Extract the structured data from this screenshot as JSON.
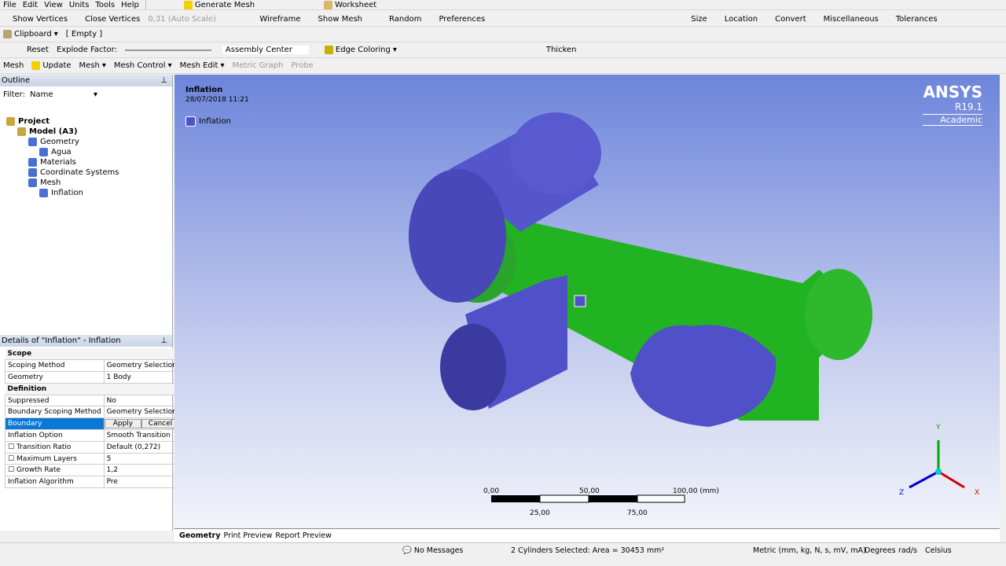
{
  "menu": [
    "File",
    "Edit",
    "View",
    "Units",
    "Tools",
    "Help"
  ],
  "toolbar1": {
    "generate_mesh": "Generate Mesh",
    "worksheet": "Worksheet"
  },
  "toolbar2": {
    "show_vertices": "Show Vertices",
    "close_vertices": "Close Vertices",
    "scale": "0,31 (Auto Scale)",
    "wireframe": "Wireframe",
    "show_mesh": "Show Mesh",
    "random": "Random",
    "preferences": "Preferences",
    "size": "Size",
    "location": "Location",
    "convert": "Convert",
    "miscellaneous": "Miscellaneous",
    "tolerances": "Tolerances"
  },
  "toolbar3": {
    "clipboard": "Clipboard",
    "clipboard_value": "[ Empty ]"
  },
  "toolbar4": {
    "reset": "Reset",
    "explode_factor": "Explode Factor:",
    "assembly_center": "Assembly Center",
    "edge_coloring": "Edge Coloring",
    "thicken": "Thicken"
  },
  "toolbar5": {
    "mesh_label": "Mesh",
    "update": "Update",
    "mesh": "Mesh",
    "mesh_control": "Mesh Control",
    "mesh_edit": "Mesh Edit",
    "metric_graph": "Metric Graph",
    "probe": "Probe"
  },
  "outline": {
    "title": "Outline",
    "filter_label": "Filter:",
    "filter_value": "Name",
    "tree": [
      {
        "label": "Project",
        "bold": true,
        "indent": 0
      },
      {
        "label": "Model (A3)",
        "bold": true,
        "indent": 1
      },
      {
        "label": "Geometry",
        "indent": 2
      },
      {
        "label": "Agua",
        "indent": 3
      },
      {
        "label": "Materials",
        "indent": 2
      },
      {
        "label": "Coordinate Systems",
        "indent": 2
      },
      {
        "label": "Mesh",
        "indent": 2
      },
      {
        "label": "Inflation",
        "indent": 3
      }
    ]
  },
  "details": {
    "title": "Details of \"Inflation\" - Inflation",
    "scope": "Scope",
    "scoping_method": [
      "Scoping Method",
      "Geometry Selection"
    ],
    "geometry": [
      "Geometry",
      "1 Body"
    ],
    "definition": "Definition",
    "suppressed": [
      "Suppressed",
      "No"
    ],
    "boundary_scoping": [
      "Boundary Scoping Method",
      "Geometry Selection"
    ],
    "boundary": "Boundary",
    "apply": "Apply",
    "cancel": "Cancel",
    "inflation_option": [
      "Inflation Option",
      "Smooth Transition"
    ],
    "transition_ratio": [
      "Transition Ratio",
      "Default (0,272)"
    ],
    "max_layers": [
      "Maximum Layers",
      "5"
    ],
    "growth_rate": [
      "Growth Rate",
      "1,2"
    ],
    "algorithm": [
      "Inflation Algorithm",
      "Pre"
    ]
  },
  "viewport": {
    "title": "Inflation",
    "date": "28/07/2018 11:21",
    "legend": "Inflation",
    "brand": "ANSYS",
    "version": "R19.1",
    "edition": "Academic",
    "scale_top": [
      "0,00",
      "50,00",
      "100,00 (mm)"
    ],
    "scale_bottom": [
      "25,00",
      "75,00"
    ],
    "axes": [
      "Y",
      "Z",
      "X"
    ],
    "colors": {
      "selected": "#5050c8",
      "body": "#1fae1f"
    }
  },
  "tabs": [
    "Geometry",
    "Print Preview",
    "Report Preview"
  ],
  "status": {
    "messages": "No Messages",
    "selection": "2 Cylinders Selected: Area = 30453 mm²",
    "units": "Metric (mm, kg, N, s, mV, mA)",
    "angle": "Degrees",
    "rate": "rad/s",
    "temp": "Celsius"
  }
}
